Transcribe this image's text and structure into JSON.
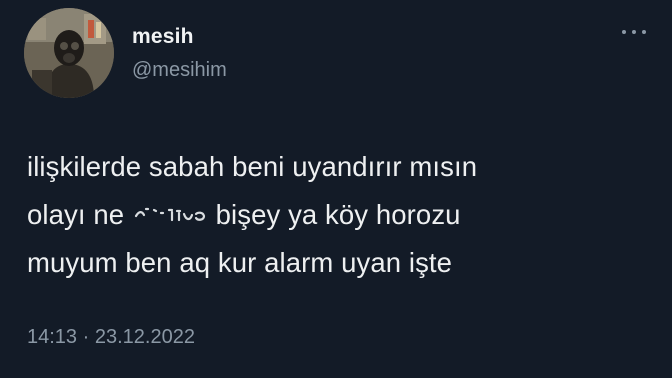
{
  "author": {
    "display_name": "mesih",
    "handle": "@mesihim"
  },
  "tweet": {
    "line1": "ilişkilerde sabah beni uyandırır mısın",
    "line2_before": "olayı ne",
    "line2_after": "bişey ya köy horozu",
    "line3": "muyum ben aq kur alarm uyan işte"
  },
  "meta": {
    "time": "14:13",
    "separator": "·",
    "date": "23.12.2022"
  },
  "icons": {
    "more": "more-horizontal-icon",
    "avatar": "profile-photo"
  },
  "colors": {
    "background": "#131b27",
    "text": "#e7e9ea",
    "secondary": "#8b98a5"
  }
}
